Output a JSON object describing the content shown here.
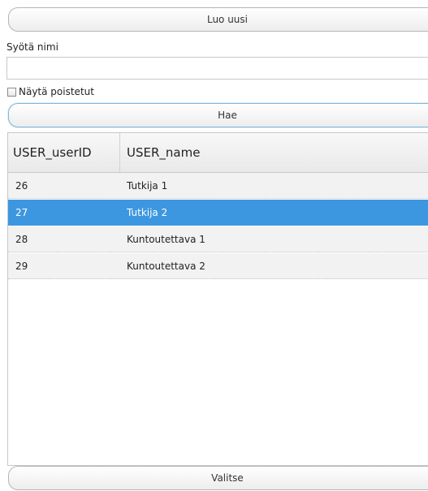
{
  "buttons": {
    "create": "Luo uusi",
    "search": "Hae",
    "select": "Valitse"
  },
  "name_field": {
    "label": "Syötä nimi",
    "value": "",
    "placeholder": ""
  },
  "show_deleted": {
    "label": "Näytä poistetut",
    "checked": false
  },
  "table": {
    "columns": [
      "USER_userID",
      "USER_name"
    ],
    "rows": [
      {
        "id": "26",
        "name": "Tutkija 1"
      },
      {
        "id": "27",
        "name": "Tutkija 2",
        "selected": true
      },
      {
        "id": "28",
        "name": "Kuntoutettava 1"
      },
      {
        "id": "29",
        "name": "Kuntoutettava 2"
      }
    ]
  },
  "colors": {
    "selected_row": "#3d97e0",
    "row_background": "#f2f2f2",
    "focus_border": "#7fb7dc"
  }
}
